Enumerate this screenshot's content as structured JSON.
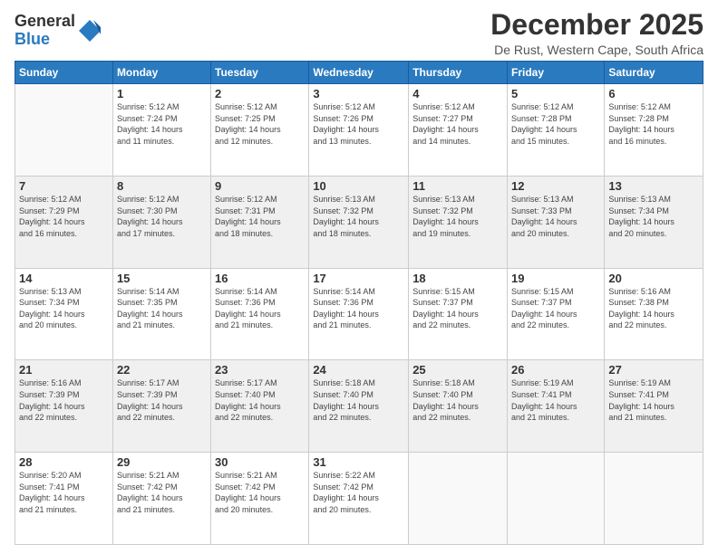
{
  "logo": {
    "general": "General",
    "blue": "Blue"
  },
  "header": {
    "month": "December 2025",
    "location": "De Rust, Western Cape, South Africa"
  },
  "weekdays": [
    "Sunday",
    "Monday",
    "Tuesday",
    "Wednesday",
    "Thursday",
    "Friday",
    "Saturday"
  ],
  "weeks": [
    [
      {
        "day": "",
        "sunrise": "",
        "sunset": "",
        "daylight": ""
      },
      {
        "day": "1",
        "sunrise": "Sunrise: 5:12 AM",
        "sunset": "Sunset: 7:24 PM",
        "daylight": "Daylight: 14 hours and 11 minutes."
      },
      {
        "day": "2",
        "sunrise": "Sunrise: 5:12 AM",
        "sunset": "Sunset: 7:25 PM",
        "daylight": "Daylight: 14 hours and 12 minutes."
      },
      {
        "day": "3",
        "sunrise": "Sunrise: 5:12 AM",
        "sunset": "Sunset: 7:26 PM",
        "daylight": "Daylight: 14 hours and 13 minutes."
      },
      {
        "day": "4",
        "sunrise": "Sunrise: 5:12 AM",
        "sunset": "Sunset: 7:27 PM",
        "daylight": "Daylight: 14 hours and 14 minutes."
      },
      {
        "day": "5",
        "sunrise": "Sunrise: 5:12 AM",
        "sunset": "Sunset: 7:28 PM",
        "daylight": "Daylight: 14 hours and 15 minutes."
      },
      {
        "day": "6",
        "sunrise": "Sunrise: 5:12 AM",
        "sunset": "Sunset: 7:28 PM",
        "daylight": "Daylight: 14 hours and 16 minutes."
      }
    ],
    [
      {
        "day": "7",
        "sunrise": "Sunrise: 5:12 AM",
        "sunset": "Sunset: 7:29 PM",
        "daylight": "Daylight: 14 hours and 16 minutes."
      },
      {
        "day": "8",
        "sunrise": "Sunrise: 5:12 AM",
        "sunset": "Sunset: 7:30 PM",
        "daylight": "Daylight: 14 hours and 17 minutes."
      },
      {
        "day": "9",
        "sunrise": "Sunrise: 5:12 AM",
        "sunset": "Sunset: 7:31 PM",
        "daylight": "Daylight: 14 hours and 18 minutes."
      },
      {
        "day": "10",
        "sunrise": "Sunrise: 5:13 AM",
        "sunset": "Sunset: 7:32 PM",
        "daylight": "Daylight: 14 hours and 18 minutes."
      },
      {
        "day": "11",
        "sunrise": "Sunrise: 5:13 AM",
        "sunset": "Sunset: 7:32 PM",
        "daylight": "Daylight: 14 hours and 19 minutes."
      },
      {
        "day": "12",
        "sunrise": "Sunrise: 5:13 AM",
        "sunset": "Sunset: 7:33 PM",
        "daylight": "Daylight: 14 hours and 20 minutes."
      },
      {
        "day": "13",
        "sunrise": "Sunrise: 5:13 AM",
        "sunset": "Sunset: 7:34 PM",
        "daylight": "Daylight: 14 hours and 20 minutes."
      }
    ],
    [
      {
        "day": "14",
        "sunrise": "Sunrise: 5:13 AM",
        "sunset": "Sunset: 7:34 PM",
        "daylight": "Daylight: 14 hours and 20 minutes."
      },
      {
        "day": "15",
        "sunrise": "Sunrise: 5:14 AM",
        "sunset": "Sunset: 7:35 PM",
        "daylight": "Daylight: 14 hours and 21 minutes."
      },
      {
        "day": "16",
        "sunrise": "Sunrise: 5:14 AM",
        "sunset": "Sunset: 7:36 PM",
        "daylight": "Daylight: 14 hours and 21 minutes."
      },
      {
        "day": "17",
        "sunrise": "Sunrise: 5:14 AM",
        "sunset": "Sunset: 7:36 PM",
        "daylight": "Daylight: 14 hours and 21 minutes."
      },
      {
        "day": "18",
        "sunrise": "Sunrise: 5:15 AM",
        "sunset": "Sunset: 7:37 PM",
        "daylight": "Daylight: 14 hours and 22 minutes."
      },
      {
        "day": "19",
        "sunrise": "Sunrise: 5:15 AM",
        "sunset": "Sunset: 7:37 PM",
        "daylight": "Daylight: 14 hours and 22 minutes."
      },
      {
        "day": "20",
        "sunrise": "Sunrise: 5:16 AM",
        "sunset": "Sunset: 7:38 PM",
        "daylight": "Daylight: 14 hours and 22 minutes."
      }
    ],
    [
      {
        "day": "21",
        "sunrise": "Sunrise: 5:16 AM",
        "sunset": "Sunset: 7:39 PM",
        "daylight": "Daylight: 14 hours and 22 minutes."
      },
      {
        "day": "22",
        "sunrise": "Sunrise: 5:17 AM",
        "sunset": "Sunset: 7:39 PM",
        "daylight": "Daylight: 14 hours and 22 minutes."
      },
      {
        "day": "23",
        "sunrise": "Sunrise: 5:17 AM",
        "sunset": "Sunset: 7:40 PM",
        "daylight": "Daylight: 14 hours and 22 minutes."
      },
      {
        "day": "24",
        "sunrise": "Sunrise: 5:18 AM",
        "sunset": "Sunset: 7:40 PM",
        "daylight": "Daylight: 14 hours and 22 minutes."
      },
      {
        "day": "25",
        "sunrise": "Sunrise: 5:18 AM",
        "sunset": "Sunset: 7:40 PM",
        "daylight": "Daylight: 14 hours and 22 minutes."
      },
      {
        "day": "26",
        "sunrise": "Sunrise: 5:19 AM",
        "sunset": "Sunset: 7:41 PM",
        "daylight": "Daylight: 14 hours and 21 minutes."
      },
      {
        "day": "27",
        "sunrise": "Sunrise: 5:19 AM",
        "sunset": "Sunset: 7:41 PM",
        "daylight": "Daylight: 14 hours and 21 minutes."
      }
    ],
    [
      {
        "day": "28",
        "sunrise": "Sunrise: 5:20 AM",
        "sunset": "Sunset: 7:41 PM",
        "daylight": "Daylight: 14 hours and 21 minutes."
      },
      {
        "day": "29",
        "sunrise": "Sunrise: 5:21 AM",
        "sunset": "Sunset: 7:42 PM",
        "daylight": "Daylight: 14 hours and 21 minutes."
      },
      {
        "day": "30",
        "sunrise": "Sunrise: 5:21 AM",
        "sunset": "Sunset: 7:42 PM",
        "daylight": "Daylight: 14 hours and 20 minutes."
      },
      {
        "day": "31",
        "sunrise": "Sunrise: 5:22 AM",
        "sunset": "Sunset: 7:42 PM",
        "daylight": "Daylight: 14 hours and 20 minutes."
      },
      {
        "day": "",
        "sunrise": "",
        "sunset": "",
        "daylight": ""
      },
      {
        "day": "",
        "sunrise": "",
        "sunset": "",
        "daylight": ""
      },
      {
        "day": "",
        "sunrise": "",
        "sunset": "",
        "daylight": ""
      }
    ]
  ]
}
